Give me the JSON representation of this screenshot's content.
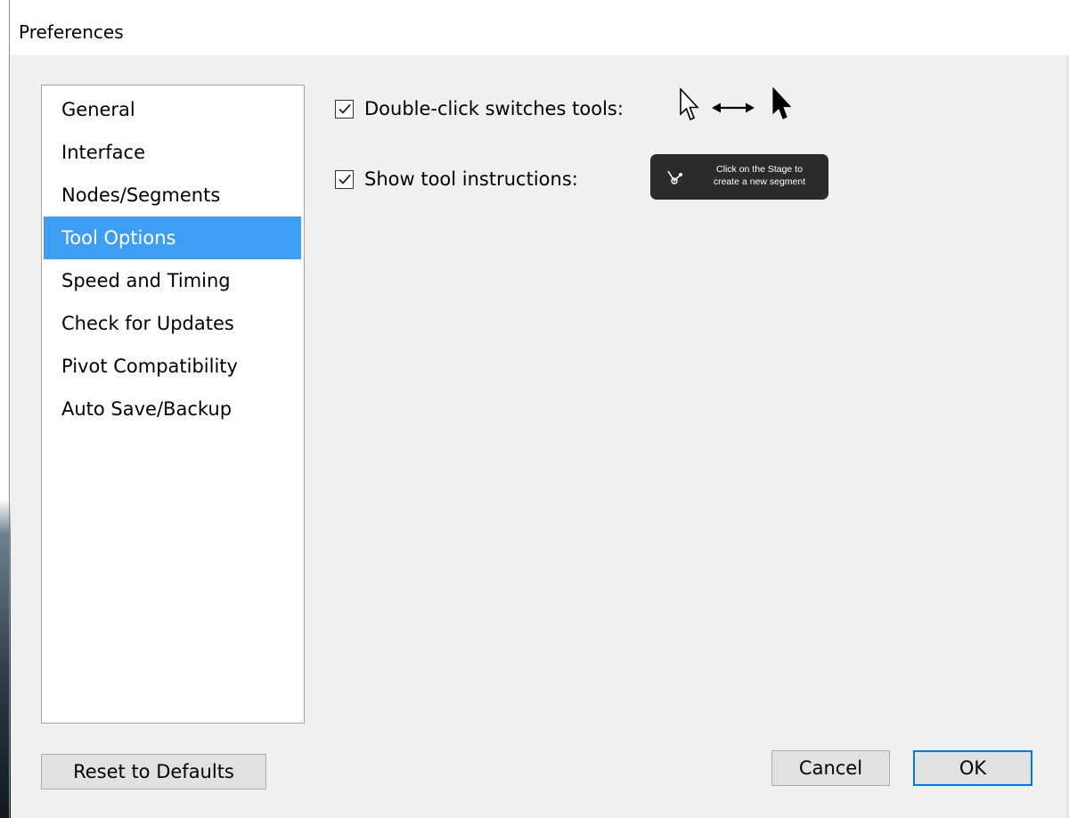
{
  "window": {
    "title": "Preferences"
  },
  "sidebar": {
    "items": [
      {
        "label": "General"
      },
      {
        "label": "Interface"
      },
      {
        "label": "Nodes/Segments"
      },
      {
        "label": "Tool Options",
        "selected": true
      },
      {
        "label": "Speed and Timing"
      },
      {
        "label": "Check for Updates"
      },
      {
        "label": "Pivot Compatibility"
      },
      {
        "label": "Auto Save/Backup"
      }
    ]
  },
  "options": {
    "double_click": {
      "label": "Double-click switches tools:",
      "checked": true,
      "preview_icons": [
        "white-arrow-cursor-icon",
        "double-arrow-icon",
        "black-arrow-cursor-icon"
      ]
    },
    "tool_instructions": {
      "label": "Show tool instructions:",
      "checked": true,
      "tooltip_preview": {
        "icon": "segment-tool-icon",
        "line1": "Click on the Stage to",
        "line2": "create a new segment"
      }
    }
  },
  "buttons": {
    "reset": "Reset to Defaults",
    "cancel": "Cancel",
    "ok": "OK"
  },
  "colors": {
    "selection": "#3e9ef4",
    "default_button_border": "#0078d7",
    "tooltip_background": "#2b2b2b"
  }
}
